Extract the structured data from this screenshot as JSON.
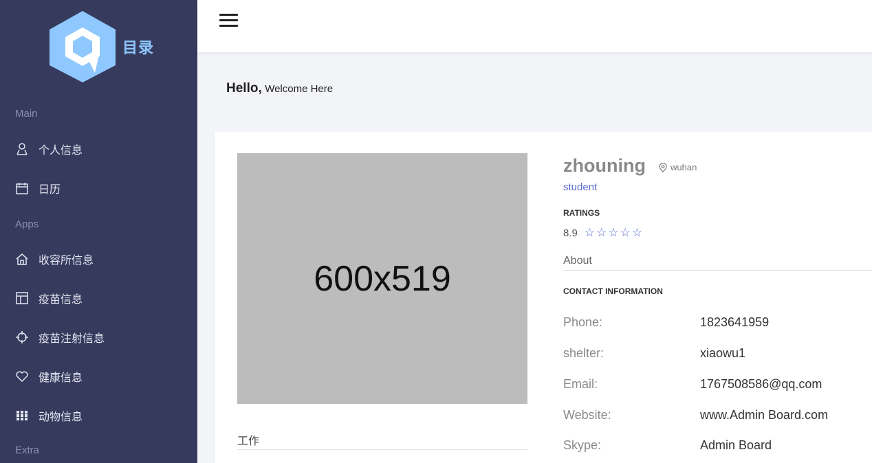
{
  "app": {
    "logo_text": "目录",
    "logo_icon": "hexagon-q-logo-icon"
  },
  "sidebar": {
    "sections": [
      {
        "label": "Main"
      },
      {
        "label": "Apps"
      },
      {
        "label": "Extra"
      }
    ],
    "items": [
      {
        "label": "个人信息",
        "icon": "user-icon"
      },
      {
        "label": "日历",
        "icon": "calendar-icon"
      },
      {
        "label": "收容所信息",
        "icon": "home-icon"
      },
      {
        "label": "疫苗信息",
        "icon": "layout-icon"
      },
      {
        "label": "疫苗注射信息",
        "icon": "crosshair-icon"
      },
      {
        "label": "健康信息",
        "icon": "heart-icon"
      },
      {
        "label": "动物信息",
        "icon": "grid-icon"
      }
    ]
  },
  "header": {
    "menu_icon": "hamburger-icon"
  },
  "greeting": {
    "hello": "Hello,",
    "welcome": "Welcome Here"
  },
  "profile": {
    "image_placeholder": "600x519",
    "work_label": "工作",
    "name": "zhouning",
    "location": "wuhan",
    "role": "student",
    "ratings_label": "RATINGS",
    "rating_value": "8.9",
    "stars": "☆☆☆☆☆",
    "about_label": "About",
    "contact_label": "CONTACT INFORMATION",
    "contact": [
      {
        "key": "Phone:",
        "value": "1823641959"
      },
      {
        "key": "shelter:",
        "value": "xiaowu1"
      },
      {
        "key": "Email:",
        "value": "1767508586@qq.com"
      },
      {
        "key": "Website:",
        "value": "www.Admin Board.com"
      },
      {
        "key": "Skype:",
        "value": "Admin Board"
      }
    ]
  },
  "colors": {
    "sidebar_bg": "#363b5e",
    "accent": "#5b6bd0",
    "logo_blue": "#8fc8ff"
  }
}
